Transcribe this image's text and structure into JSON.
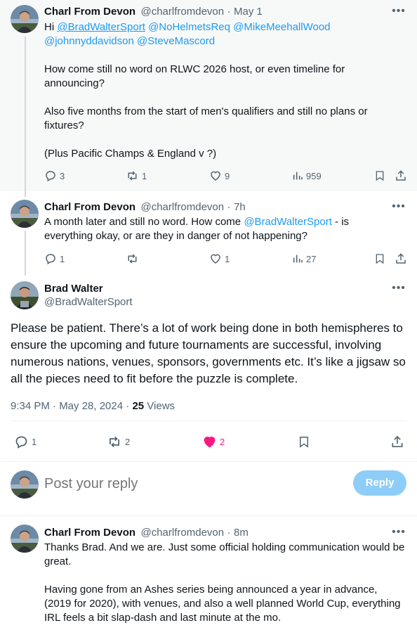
{
  "tweet1": {
    "display_name": "Charl From Devon",
    "handle": "@charlfromdevon",
    "separator": "·",
    "time": "May 1",
    "text_hi": "Hi",
    "mentions": [
      "@BradWalterSport",
      "@NoHelmetsReq",
      "@MikeMeehallWood",
      "@johnnyddavidson",
      "@SteveMascord"
    ],
    "para1": "How come still no word on RLWC 2026 host, or even timeline for announcing?",
    "para2": "Also five months from the start of men's qualifiers and still no plans or fixtures?",
    "para3": "(Plus Pacific Champs & England v ?)",
    "replies": "3",
    "reposts": "1",
    "likes": "9",
    "views": "959"
  },
  "tweet2": {
    "display_name": "Charl From Devon",
    "handle": "@charlfromdevon",
    "separator": "·",
    "time": "7h",
    "text_a": "A month later and still no word. How come",
    "mention": "@BradWalterSport",
    "text_b": "- is everything okay, or are they in danger of not happening?",
    "replies": "1",
    "reposts": "",
    "likes": "1",
    "views": "27"
  },
  "main_tweet": {
    "display_name": "Brad Walter",
    "handle": "@BradWalterSport",
    "text": "Please be patient. There’s a lot of work being done in both hemispheres to ensure the upcoming and future tournaments are successful, involving numerous nations, venues, sponsors, governments etc. It’s like a jigsaw so all the pieces need to fit before the puzzle is complete.",
    "timestamp": "9:34 PM · May 28, 2024",
    "separator": "·",
    "views_count": "25",
    "views_label": "Views",
    "replies": "1",
    "reposts": "2",
    "likes": "2"
  },
  "composer": {
    "placeholder": "Post your reply",
    "reply_button": "Reply"
  },
  "reply1": {
    "display_name": "Charl From Devon",
    "handle": "@charlfromdevon",
    "separator": "·",
    "time": "8m",
    "para1": "Thanks Brad. And we are. Just some official holding communication would be great.",
    "para2": "Having gone from an Ashes series being announced a year in advance, (2019 for 2020), with venues, and also a well planned World Cup, everything IRL feels a bit slap-dash and last minute at the mo."
  },
  "colors": {
    "accent": "#1d9bf0",
    "like_active": "#f91880",
    "secondary_text": "#536471",
    "reply_button_disabled": "#8ecdf8"
  },
  "icons": {
    "reply": "reply-icon",
    "repost": "repost-icon",
    "like": "heart-icon",
    "views": "views-chart-icon",
    "bookmark": "bookmark-icon",
    "share": "share-icon",
    "more": "more-dots-icon"
  }
}
